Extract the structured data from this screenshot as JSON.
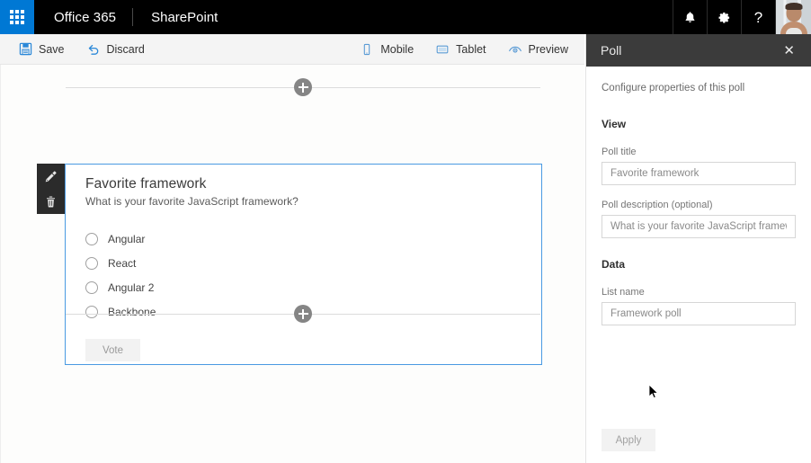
{
  "suite_bar": {
    "waffle_label": "app-launcher",
    "brand": "Office 365",
    "app": "SharePoint",
    "notifications_icon": "bell-icon",
    "settings_icon": "gear-icon",
    "help_label": "?",
    "avatar_label": "user-avatar"
  },
  "command_bar": {
    "save_label": "Save",
    "discard_label": "Discard",
    "mobile_label": "Mobile",
    "tablet_label": "Tablet",
    "preview_label": "Preview"
  },
  "canvas": {
    "add_section_top_label": "Add a new section",
    "add_section_bottom_label": "Add a new section",
    "edit_rail": {
      "edit_icon": "pencil-icon",
      "delete_icon": "trash-icon"
    },
    "poll": {
      "title": "Favorite framework",
      "description": "What is your favorite JavaScript framework?",
      "options": [
        {
          "label": "Angular",
          "selected": false
        },
        {
          "label": "React",
          "selected": false
        },
        {
          "label": "Angular 2",
          "selected": false
        },
        {
          "label": "Backbone",
          "selected": false
        }
      ],
      "vote_button": "Vote"
    }
  },
  "property_pane": {
    "title": "Poll",
    "close_icon": "close-icon",
    "subtitle": "Configure properties of this poll",
    "groups": [
      {
        "heading": "View",
        "fields": [
          {
            "label": "Poll title",
            "value": "Favorite framework"
          },
          {
            "label": "Poll description (optional)",
            "value": "What is your favorite JavaScript framework?"
          }
        ]
      },
      {
        "heading": "Data",
        "fields": [
          {
            "label": "List name",
            "value": "Framework poll"
          }
        ]
      }
    ],
    "apply_label": "Apply"
  },
  "colors": {
    "suite_bar_bg": "#000000",
    "waffle_bg": "#0078d4",
    "accent_blue": "#0078d4",
    "card_border": "#4a9ae2",
    "pane_header_bg": "#3b3b3b",
    "command_bar_bg": "#f4f4f4"
  }
}
